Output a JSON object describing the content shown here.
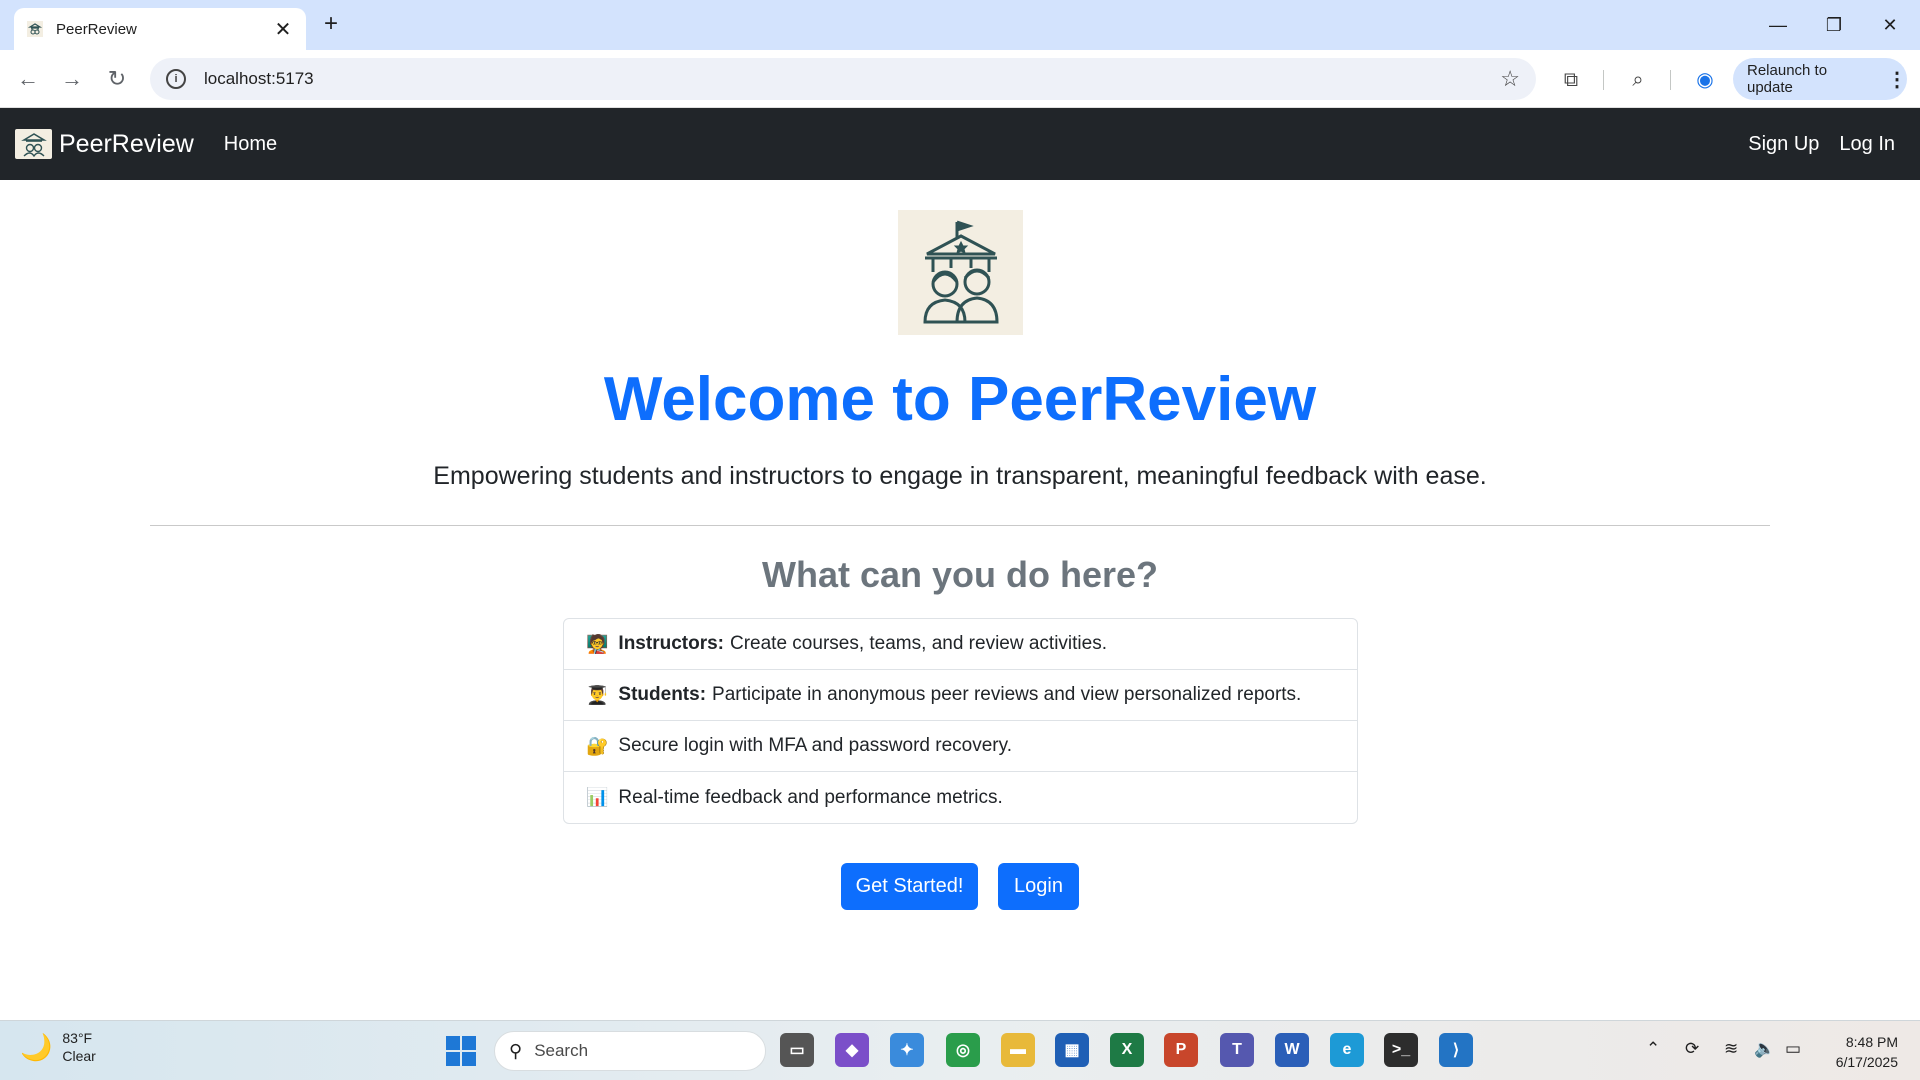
{
  "browser": {
    "tab_title": "PeerReview",
    "tab_close": "✕",
    "new_tab": "+",
    "url": "localhost:5173",
    "relaunch_label": "Relaunch to update"
  },
  "navbar": {
    "brand": "PeerReview",
    "home": "Home",
    "sign_up": "Sign Up",
    "log_in": "Log In"
  },
  "hero": {
    "title": "Welcome to PeerReview",
    "subtitle": "Empowering students and instructors to engage in transparent, meaningful feedback with ease."
  },
  "features": {
    "heading": "What can you do here?",
    "items": [
      {
        "emoji": "🧑‍🏫",
        "strong": "Instructors:",
        "text": "Create courses, teams, and review activities."
      },
      {
        "emoji": "👨‍🎓",
        "strong": "Students:",
        "text": "Participate in anonymous peer reviews and view personalized reports."
      },
      {
        "emoji": "🔐",
        "strong": "",
        "text": "Secure login with MFA and password recovery."
      },
      {
        "emoji": "📊",
        "strong": "",
        "text": "Real-time feedback and performance metrics."
      }
    ]
  },
  "actions": {
    "get_started": "Get Started!",
    "login": "Login"
  },
  "taskbar": {
    "weather_temp": "83°F",
    "weather_desc": "Clear",
    "search_placeholder": "Search",
    "time": "8:48 PM",
    "date": "6/17/2025"
  },
  "colors": {
    "primary": "#0d6efd",
    "navbar_bg": "#212529",
    "tabbar_bg": "#d3e3fd",
    "logo_bg": "#f3eee2",
    "logo_ink": "#2f5254"
  }
}
